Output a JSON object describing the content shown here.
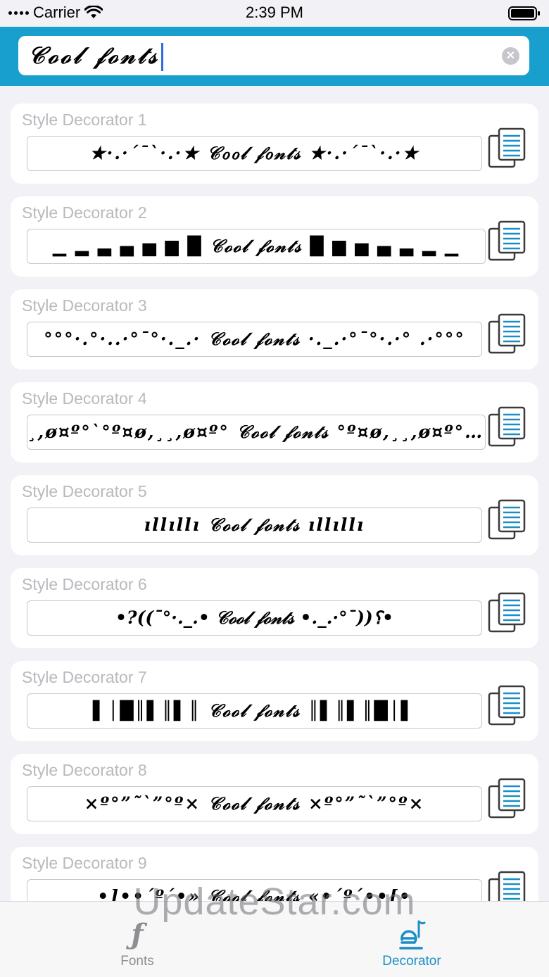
{
  "status_bar": {
    "carrier": "Carrier",
    "time": "2:39 PM"
  },
  "search": {
    "value": "𝒞ℴℴ𝓁 𝒻ℴ𝓃𝓉𝓈",
    "clear_icon": "clear-icon"
  },
  "decorators": [
    {
      "title": "Style Decorator 1",
      "text": "★·.·´¯`·.·★ 𝒞ℴℴ𝓁 𝒻ℴ𝓃𝓉𝓈 ★·.·´¯`·.·★"
    },
    {
      "title": "Style Decorator 2",
      "text": "▁ ▂ ▃ ▄ ▅ ▆ █ 𝒞ℴℴ𝓁 𝒻ℴ𝓃𝓉𝓈 █ ▆ ▅ ▄ ▃ ▂ ▁"
    },
    {
      "title": "Style Decorator 3",
      "text": "°°°·.°·..·°¯°·._.· 𝒞ℴℴ𝓁 𝒻ℴ𝓃𝓉𝓈 ·._.·°¯°·.·° .·°°°"
    },
    {
      "title": "Style Decorator 4",
      "text": "¸,ø¤º°`°º¤ø,¸¸,ø¤º° 𝒞ℴℴ𝓁 𝒻ℴ𝓃𝓉𝓈 °º¤ø,¸¸,ø¤º°`°º¤ø,¸"
    },
    {
      "title": "Style Decorator 5",
      "text": "ıllıllı 𝒞ℴℴ𝓁 𝒻ℴ𝓃𝓉𝓈 ıllıllı"
    },
    {
      "title": "Style Decorator 6",
      "text": "•?((¯°·._.• 𝒞ℴℴ𝓁 𝒻ℴ𝓃𝓉𝓈 •._.·°¯))؟•"
    },
    {
      "title": "Style Decorator 7",
      "text": "▌│█║▌║▌║ 𝒞ℴℴ𝓁 𝒻ℴ𝓃𝓉𝓈 ║▌║▌║█│▌"
    },
    {
      "title": "Style Decorator 8",
      "text": "×º°”˜`”°º× 𝒞ℴℴ𝓁 𝒻ℴ𝓃𝓉𝓈 ×º°”˜`”°º×"
    },
    {
      "title": "Style Decorator 9",
      "text": "•]••´º´•» 𝒞ℴℴ𝓁 𝒻ℴ𝓃𝓉𝓈 «•´º´••[•"
    }
  ],
  "copy_icon": "copy-icon",
  "tabs": [
    {
      "label": "Fonts",
      "icon": "font-icon",
      "selected": false
    },
    {
      "label": "Decorator",
      "icon": "decorator-icon",
      "selected": true
    }
  ],
  "colors": {
    "header": "#189fcd",
    "accent": "#1b8ec6",
    "caret": "#2e6de0"
  },
  "watermark": "UpdateStar.com"
}
